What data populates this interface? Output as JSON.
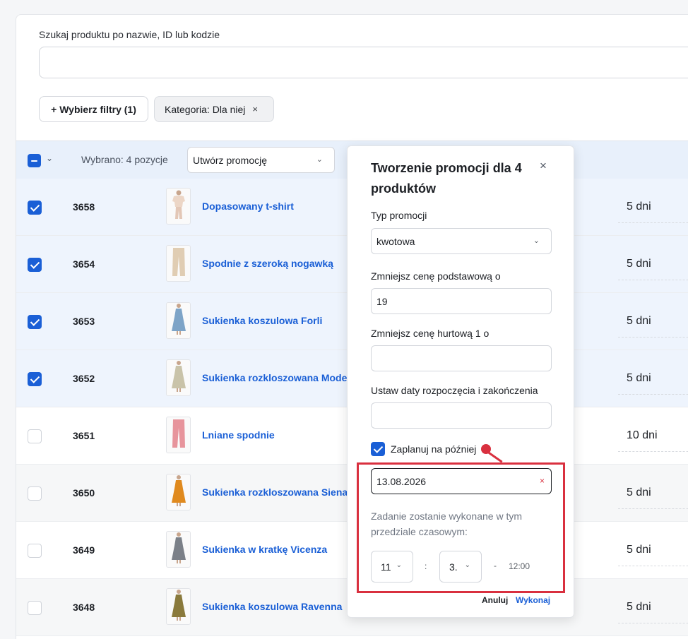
{
  "search": {
    "label": "Szukaj produktu po nazwie, ID lub kodzie",
    "value": "",
    "placeholder": ""
  },
  "filters": {
    "button_label": "+ Wybierz filtry (1)",
    "active_chip": "Kategoria: Dla niej",
    "chip_remove": "×"
  },
  "bulk": {
    "selected_text": "Wybrano: 4 pozycje",
    "action_select_value": "Utwórz promocję",
    "chevron": "⌄"
  },
  "rows": [
    {
      "id": "3658",
      "name": "Dopasowany t-shirt",
      "days": "5 dni",
      "checked": true,
      "garment_color": "#ecd6c6",
      "garment_icon": "tshirt-icon"
    },
    {
      "id": "3654",
      "name": "Spodnie z szeroką nogawką",
      "days": "5 dni",
      "checked": true,
      "garment_color": "#e0cdb3",
      "garment_icon": "trousers-icon"
    },
    {
      "id": "3653",
      "name": "Sukienka koszulowa Forli",
      "days": "5 dni",
      "checked": true,
      "garment_color": "#7ea4c7",
      "garment_icon": "dress-icon"
    },
    {
      "id": "3652",
      "name": "Sukienka rozkloszowana Modena",
      "days": "5 dni",
      "checked": true,
      "garment_color": "#c9c3a9",
      "garment_icon": "dress-icon"
    },
    {
      "id": "3651",
      "name": "Lniane spodnie",
      "days": "10 dni",
      "checked": false,
      "garment_color": "#e7949c",
      "garment_icon": "trousers-icon"
    },
    {
      "id": "3650",
      "name": "Sukienka rozkloszowana Siena",
      "days": "5 dni",
      "checked": false,
      "garment_color": "#e08a1e",
      "garment_icon": "dress-icon"
    },
    {
      "id": "3649",
      "name": "Sukienka w kratkę Vicenza",
      "days": "5 dni",
      "checked": false,
      "garment_color": "#7b8088",
      "garment_icon": "dress-icon"
    },
    {
      "id": "3648",
      "name": "Sukienka koszulowa Ravenna",
      "days": "5 dni",
      "checked": false,
      "garment_color": "#8a7a3c",
      "garment_icon": "dress-icon"
    }
  ],
  "popover": {
    "title": "Tworzenie promocji dla 4 produktów",
    "close": "×",
    "type_label": "Typ promocji",
    "type_value": "kwotowa",
    "base_label": "Zmniejsz cenę podstawową o",
    "base_value": "19",
    "wholesale_label": "Zmniejsz cenę hurtową 1 o",
    "wholesale_value": "",
    "dates_label": "Ustaw daty rozpoczęcia i zakończenia",
    "dates_value": "",
    "schedule_label": "Zaplanuj na później",
    "schedule_checked": true,
    "schedule_date": "13.08.2026",
    "clear": "×",
    "hint": "Zadanie zostanie wykonane w tym przedziale czasowym:",
    "hour": "11",
    "minute": "3.",
    "colon": ":",
    "dash": "-",
    "end_time": "12:00",
    "cancel": "Anuluj",
    "run": "Wykonaj"
  },
  "colors": {
    "accent": "#1a5fd6",
    "highlight": "#d9303f"
  }
}
